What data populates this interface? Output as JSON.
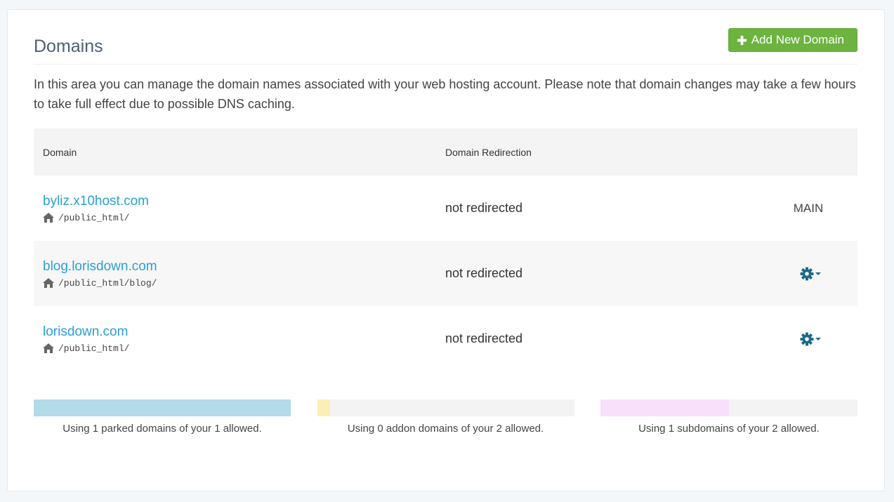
{
  "page": {
    "title": "Domains",
    "add_button_label": "Add New Domain",
    "intro": "In this area you can manage the domain names associated with your web hosting account. Please note that domain changes may take a few hours to take full effect due to possible DNS caching."
  },
  "table": {
    "headers": [
      "Domain",
      "Domain Redirection",
      ""
    ],
    "rows": [
      {
        "domain": "byliz.x10host.com",
        "path": "/public_html/",
        "redirection": "not redirected",
        "action": "MAIN"
      },
      {
        "domain": "blog.lorisdown.com",
        "path": "/public_html/blog/",
        "redirection": "not redirected",
        "action": "gear-icon"
      },
      {
        "domain": "lorisdown.com",
        "path": "/public_html/",
        "redirection": "not redirected",
        "action": "gear-icon"
      }
    ]
  },
  "usage": [
    {
      "text": "Using 1 parked domains of your 1 allowed.",
      "fraction": 1.0,
      "color": "#b3dae8"
    },
    {
      "text": "Using 0 addon domains of your 2 allowed.",
      "fraction": 0.05,
      "color": "#fcefb4"
    },
    {
      "text": "Using 1 subdomains of your 2 allowed.",
      "fraction": 0.5,
      "color": "#f8dffa"
    }
  ],
  "colors": {
    "accent_green": "#6db33f",
    "link_blue": "#2a9fd6",
    "gear_blue": "#1f6a8a"
  }
}
